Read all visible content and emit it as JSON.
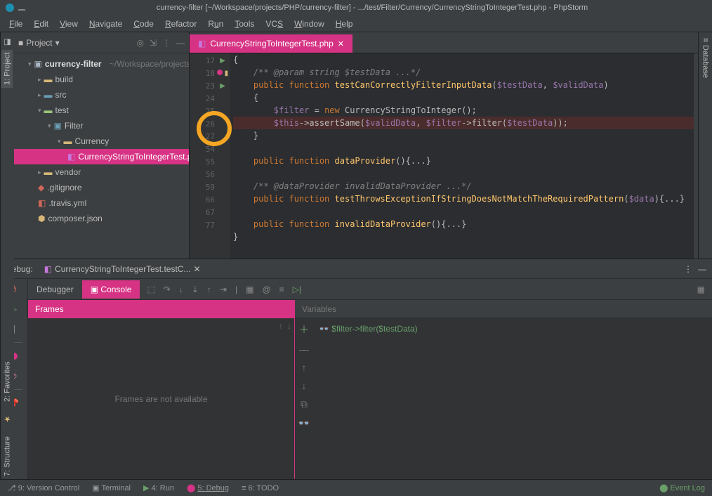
{
  "titlebar": {
    "title": "currency-filter [~/Workspace/projects/PHP/currency-filter] - .../test/Filter/Currency/CurrencyStringToIntegerTest.php - PhpStorm"
  },
  "menu": [
    "File",
    "Edit",
    "View",
    "Navigate",
    "Code",
    "Refactor",
    "Run",
    "Tools",
    "VCS",
    "Window",
    "Help"
  ],
  "project": {
    "label": "Project",
    "root": {
      "name": "currency-filter",
      "path": "~/Workspace/projects/PHP/currency-filter"
    },
    "nodes": [
      {
        "name": "build",
        "type": "folder"
      },
      {
        "name": "src",
        "type": "folder"
      },
      {
        "name": "test",
        "type": "folder-open",
        "children": [
          {
            "name": "Filter",
            "type": "folder-open",
            "children": [
              {
                "name": "Currency",
                "type": "folder-open",
                "children": [
                  {
                    "name": "CurrencyStringToIntegerTest.php",
                    "type": "file",
                    "selected": true
                  }
                ]
              }
            ]
          }
        ]
      },
      {
        "name": "vendor",
        "type": "folder"
      },
      {
        "name": ".gitignore",
        "type": "file-red"
      },
      {
        "name": ".travis.yml",
        "type": "file-red"
      },
      {
        "name": "composer.json",
        "type": "file"
      }
    ]
  },
  "editor": {
    "tab": "CurrencyStringToIntegerTest.php",
    "lines": [
      {
        "n": 17,
        "html": "{"
      },
      {
        "n": 18,
        "html": "    <span class='k-grey k-italic'>/** @param string $testData ...*/</span>"
      },
      {
        "n": 23,
        "run": true,
        "html": "    <span class='k-orange'>public function</span> <span class='k-yellow'>testCanCorrectlyFilterInputData</span>(<span class='k-purple'>$testData</span>, <span class='k-purple'>$validData</span>)"
      },
      {
        "n": 24,
        "html": "    {"
      },
      {
        "n": 25,
        "html": "        <span class='k-purple'>$filter</span> = <span class='k-orange'>new</span> CurrencyStringToInteger();"
      },
      {
        "n": 26,
        "bp": true,
        "hl": true,
        "html": "        <span class='k-purple'>$this</span>->assertSame(<span class='k-purple'>$validData</span>, <span class='k-purple'>$filter</span>->filter(<span class='k-purple'>$testData</span>));"
      },
      {
        "n": 27,
        "html": "    }"
      },
      {
        "n": "",
        "html": ""
      },
      {
        "n": 54,
        "html": "    <span class='k-orange'>public function</span> <span class='k-yellow'>dataProvider</span>(){...}"
      },
      {
        "n": 55,
        "html": ""
      },
      {
        "n": 56,
        "html": "    <span class='k-grey k-italic'>/** @dataProvider invalidDataProvider ...*/</span>"
      },
      {
        "n": 59,
        "run": true,
        "html": "    <span class='k-orange'>public function</span> <span class='k-yellow'>testThrowsExceptionIfStringDoesNotMatchTheRequiredPattern</span>(<span class='k-purple'>$data</span>){...}"
      },
      {
        "n": 66,
        "html": ""
      },
      {
        "n": 67,
        "html": "    <span class='k-orange'>public function</span> <span class='k-yellow'>invalidDataProvider</span>(){...}"
      },
      {
        "n": 77,
        "html": "}"
      }
    ]
  },
  "debug": {
    "title": "Debug:",
    "session": "CurrencyStringToIntegerTest.testC...",
    "tab_debugger": "Debugger",
    "tab_console": "Console",
    "frames_hdr": "Frames",
    "frames_msg": "Frames are not available",
    "vars_hdr": "Variables",
    "var_expr": "$filter->filter($testData)"
  },
  "statusbar": {
    "items": [
      "9: Version Control",
      "Terminal",
      "4: Run",
      "5: Debug",
      "6: TODO"
    ],
    "eventlog": "Event Log"
  },
  "sidestripe": [
    "2: Favorites",
    "7: Structure"
  ],
  "leftstripe": "1: Project",
  "rightstripe": "Database"
}
